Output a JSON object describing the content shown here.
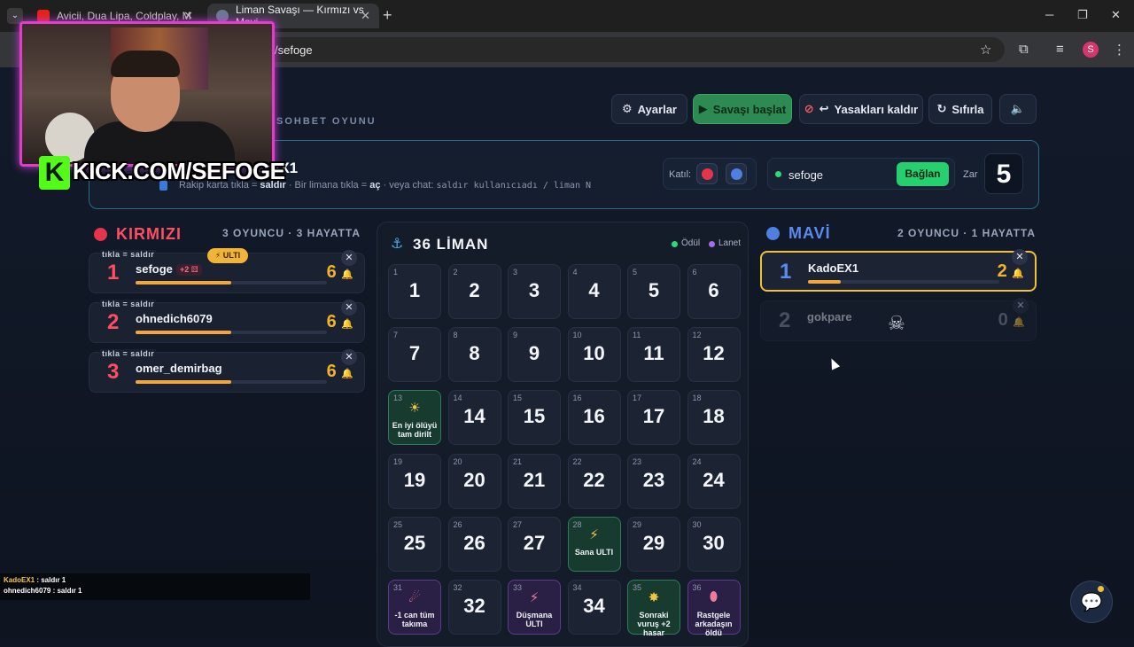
{
  "browser": {
    "tabs": [
      {
        "title": "Avicii, Dua Lipa, Coldplay, M",
        "favicon_color": "#e62117"
      },
      {
        "title": "Liman Savaşı — Kırmızı vs Mavi",
        "favicon_color": "#6b7a90"
      }
    ],
    "url": "/sefoge"
  },
  "toolbar": {
    "settings": "Ayarlar",
    "start": "Savaşı başlat",
    "unban": "Yasakları kaldır",
    "reset": "Sıfırla"
  },
  "header": {
    "subtitle": "SOHBET OYUNU",
    "title_tail": "EX1",
    "hint_pre": "Rakip karta tıkla = ",
    "hint_b1": "saldır",
    "hint_mid": " · Bir limana tıkla = ",
    "hint_b2": "aç",
    "hint_post": " · veya chat: ",
    "hint_code": "saldır kullanıcıadı / liman N"
  },
  "controls": {
    "join_label": "Katıl:",
    "channel": "sefoge",
    "connect": "Bağlan",
    "dice_label": "Zar",
    "dice_value": "5"
  },
  "red_team": {
    "name": "KIRMIZI",
    "count": "3 OYUNCU · 3 HAYATTA",
    "color": "#e5344c",
    "ulti_badge": "⚡ ULTI",
    "players": [
      {
        "tag": "tıkla = saldır",
        "rank": "1",
        "name": "sefoge",
        "badge": "+2 ⚄",
        "lives": "6",
        "bar": 0.5
      },
      {
        "tag": "tıkla = saldır",
        "rank": "2",
        "name": "ohnedich6079",
        "lives": "6",
        "bar": 0.5
      },
      {
        "tag": "tıkla = saldır",
        "rank": "3",
        "name": "omer_demirbag",
        "lives": "6",
        "bar": 0.5
      }
    ]
  },
  "blue_team": {
    "name": "MAVİ",
    "count": "2 OYUNCU · 1 HAYATTA",
    "color": "#4f7fe0",
    "players": [
      {
        "rank": "1",
        "name": "KadoEX1",
        "lives": "2",
        "bar": 0.17
      },
      {
        "rank": "2",
        "name": "gokpare",
        "lives": "0",
        "bar": 0
      }
    ]
  },
  "board": {
    "title": "36 LİMAN",
    "legend": [
      {
        "label": "Ödül",
        "color": "#2ad97a"
      },
      {
        "label": "Lanet",
        "color": "#a76bf0"
      }
    ],
    "cells": [
      {
        "n": "1"
      },
      {
        "n": "2"
      },
      {
        "n": "3"
      },
      {
        "n": "4"
      },
      {
        "n": "5"
      },
      {
        "n": "6"
      },
      {
        "n": "7"
      },
      {
        "n": "8"
      },
      {
        "n": "9"
      },
      {
        "n": "10"
      },
      {
        "n": "11"
      },
      {
        "n": "12"
      },
      {
        "n": "13",
        "kind": "reward",
        "icon": "☀",
        "label": "En iyi ölüyü tam dirilt"
      },
      {
        "n": "14"
      },
      {
        "n": "15"
      },
      {
        "n": "16"
      },
      {
        "n": "17"
      },
      {
        "n": "18"
      },
      {
        "n": "19"
      },
      {
        "n": "20"
      },
      {
        "n": "21"
      },
      {
        "n": "22"
      },
      {
        "n": "23"
      },
      {
        "n": "24"
      },
      {
        "n": "25"
      },
      {
        "n": "26"
      },
      {
        "n": "27"
      },
      {
        "n": "28",
        "kind": "reward",
        "icon": "⚡",
        "label": "Sana ULTI"
      },
      {
        "n": "29"
      },
      {
        "n": "30"
      },
      {
        "n": "31",
        "kind": "curse",
        "icon": "☄",
        "label": "-1 can tüm takıma"
      },
      {
        "n": "32"
      },
      {
        "n": "33",
        "kind": "curse",
        "icon": "⚡",
        "label": "Düşmana ULTI"
      },
      {
        "n": "34"
      },
      {
        "n": "35",
        "kind": "reward",
        "icon": "✸",
        "label": "Sonraki vuruş +2 hasar"
      },
      {
        "n": "36",
        "kind": "curse",
        "icon": "⬮",
        "label": "Rastgele arkadaşın öldü"
      }
    ]
  },
  "overlay": {
    "kick_text": "KICK.COM/SEFOGE",
    "kick_k": "K",
    "chat": [
      {
        "user": "KadoEX1",
        "msg": " : saldır 1"
      },
      {
        "user": "ohnedich6079",
        "msg": " : saldır 1"
      }
    ]
  }
}
